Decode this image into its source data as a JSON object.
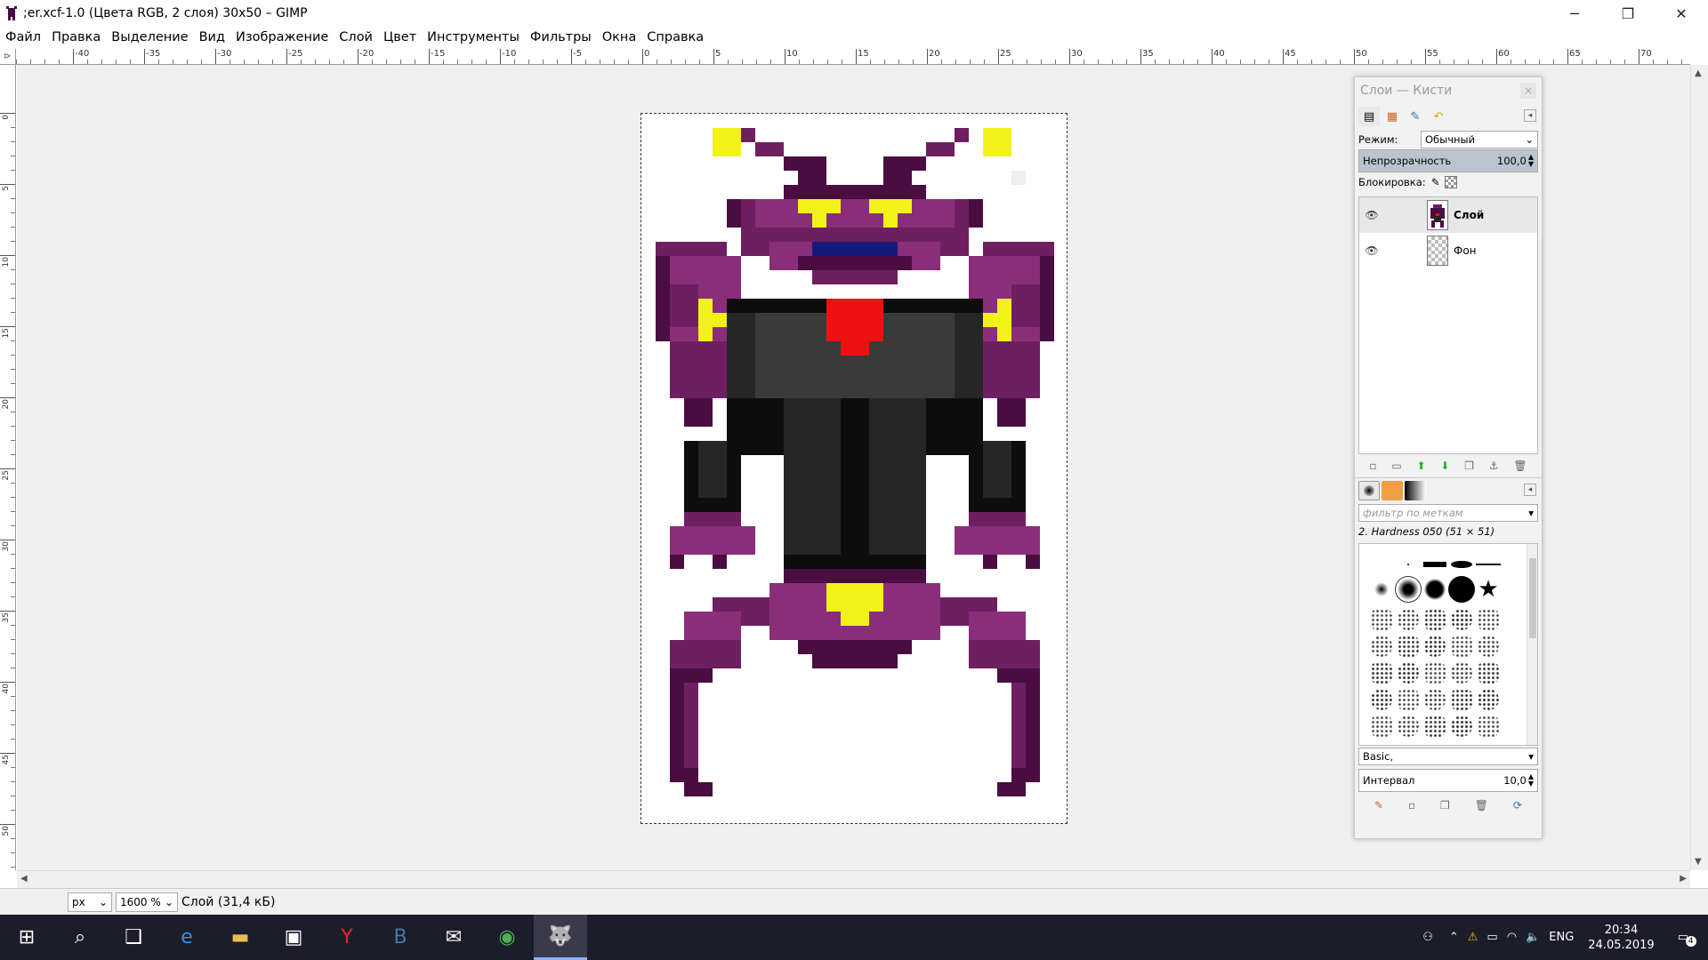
{
  "window": {
    "title": ";er.xcf-1.0 (Цвета RGB, 2 слоя) 30x50 – GIMP",
    "minimize": "─",
    "maximize": "❐",
    "close": "✕"
  },
  "menu": [
    "Файл",
    "Правка",
    "Выделение",
    "Вид",
    "Изображение",
    "Слой",
    "Цвет",
    "Инструменты",
    "Фильтры",
    "Окна",
    "Справка"
  ],
  "ruler": {
    "h_labels": [
      "-40",
      "-35",
      "-30",
      "-25",
      "-20",
      "-15",
      "-10",
      "-5",
      "0",
      "5",
      "10",
      "15",
      "20",
      "25",
      "30",
      "35",
      "40",
      "45",
      "50",
      "55",
      "60",
      "65",
      "70"
    ],
    "v_labels": [
      "0",
      "5",
      "10",
      "15",
      "20",
      "25",
      "30",
      "35",
      "40",
      "45",
      "50"
    ]
  },
  "statusbar": {
    "unit": "px",
    "zoom": "1600 %",
    "info": "Слой (31,4 кБ)"
  },
  "dock": {
    "title": "Слои — Кисти",
    "close": "×",
    "mode_label": "Режим:",
    "mode_value": "Обычный",
    "opacity_label": "Непрозрачность",
    "opacity_value": "100,0",
    "lock_label": "Блокировка:",
    "layers": [
      {
        "name": "Слой",
        "active": true
      },
      {
        "name": "Фон",
        "active": false
      }
    ],
    "brush_filter_placeholder": "фильтр по меткам",
    "brush_name": "2. Hardness 050 (51 × 51)",
    "brush_tag": "Basic,",
    "spacing_label": "Интервал",
    "spacing_value": "10,0"
  },
  "taskbar": {
    "lang": "ENG",
    "time": "20:34",
    "date": "24.05.2019",
    "notifications": "4"
  },
  "colors": {
    "purple_light": "#8a2e7a",
    "purple_mid": "#6e1f62",
    "purple_dark": "#4a0d42",
    "yellow": "#f2f21a",
    "red": "#ee1111",
    "blue": "#141a7a",
    "black": "#0d0d0d",
    "grey_dark": "#262626",
    "grey_mid": "#3a3a3a"
  }
}
